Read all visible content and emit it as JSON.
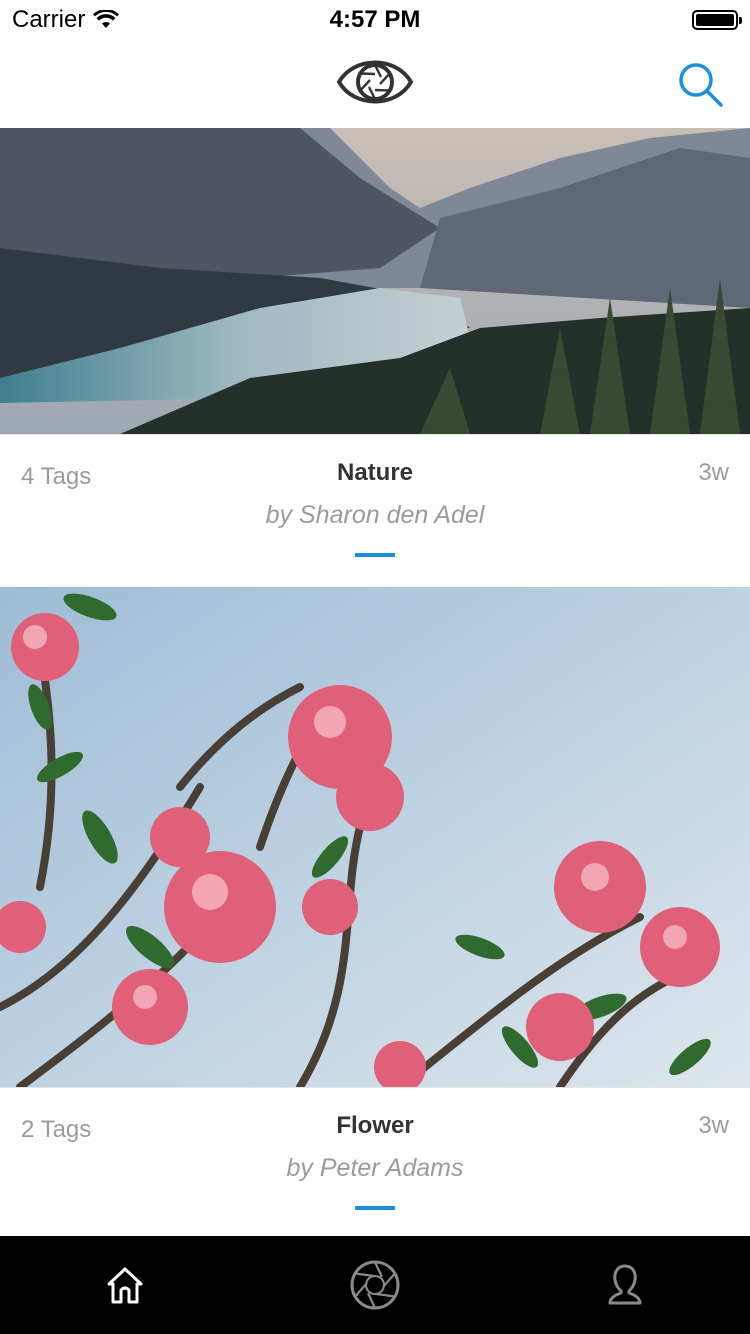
{
  "status_bar": {
    "carrier": "Carrier",
    "time": "4:57 PM"
  },
  "nav": {
    "logo_icon": "eye-aperture-logo",
    "search_icon": "search-icon"
  },
  "colors": {
    "accent": "#1a8fe0",
    "tab_bar": "#000000",
    "muted_text": "#9b9b9b",
    "title_text": "#333333"
  },
  "posts": [
    {
      "tags": "4 Tags",
      "title": "Nature",
      "author": "by Sharon den Adel",
      "age": "3w",
      "photo": "mountain-lake-photo"
    },
    {
      "tags": "2 Tags",
      "title": "Flower",
      "author": "by Peter Adams",
      "age": "3w",
      "photo": "pink-flowers-photo"
    }
  ],
  "tabs": [
    {
      "icon": "home-icon"
    },
    {
      "icon": "aperture-icon"
    },
    {
      "icon": "profile-icon"
    }
  ]
}
